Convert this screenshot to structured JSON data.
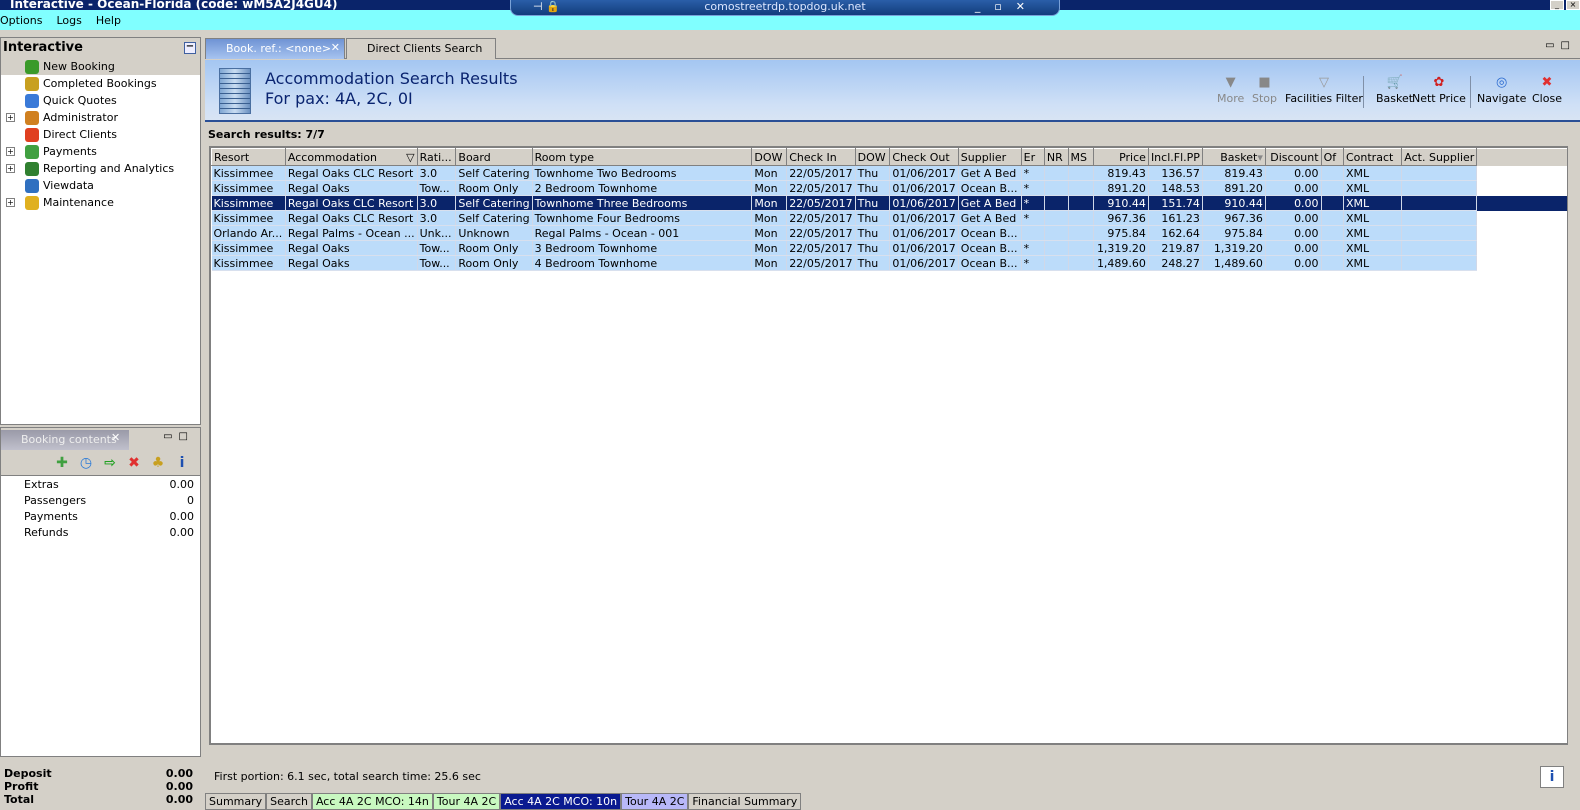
{
  "window": {
    "title": "Interactive - Ocean-Florida (code: wM5A2J4GU4)",
    "remote_host": "comostreetrdp.topdog.uk.net"
  },
  "menu": [
    "Options",
    "Logs",
    "Help"
  ],
  "left": {
    "title": "Interactive",
    "tree": [
      {
        "label": "New Booking",
        "expandable": false,
        "selected": true,
        "icon": "palm-tree-icon",
        "color": "#3a9a2a"
      },
      {
        "label": "Completed Bookings",
        "expandable": false,
        "icon": "palm-tree-icon",
        "color": "#c8a020"
      },
      {
        "label": "Quick Quotes",
        "expandable": false,
        "icon": "clock-icon",
        "color": "#3a7ad8"
      },
      {
        "label": "Administrator",
        "expandable": true,
        "icon": "person-icon",
        "color": "#d08020"
      },
      {
        "label": "Direct Clients",
        "expandable": false,
        "icon": "client-icon",
        "color": "#e04020"
      },
      {
        "label": "Payments",
        "expandable": true,
        "icon": "payments-icon",
        "color": "#40a040"
      },
      {
        "label": "Reporting and Analytics",
        "expandable": true,
        "icon": "report-icon",
        "color": "#308030"
      },
      {
        "label": "Viewdata",
        "expandable": false,
        "icon": "globe-icon",
        "color": "#3070c0"
      },
      {
        "label": "Maintenance",
        "expandable": true,
        "icon": "maintenance-icon",
        "color": "#e0b020"
      }
    ]
  },
  "booking_contents": {
    "title": "Booking contents",
    "tools": [
      {
        "name": "add-icon",
        "glyph": "✚",
        "color": "#40a040"
      },
      {
        "name": "clock-icon",
        "glyph": "◷",
        "color": "#2a7ad8"
      },
      {
        "name": "basket-transfer-icon",
        "glyph": "⇨",
        "color": "#20a020"
      },
      {
        "name": "delete-icon",
        "glyph": "✖",
        "color": "#e03030"
      },
      {
        "name": "palm-tree-icon",
        "glyph": "♣",
        "color": "#c8a020"
      },
      {
        "name": "info-icon",
        "glyph": "i",
        "color": "#1d4fb0"
      }
    ],
    "rows": [
      {
        "label": "Extras",
        "value": "0.00"
      },
      {
        "label": "Passengers",
        "value": "0"
      },
      {
        "label": "Payments",
        "value": "0.00"
      },
      {
        "label": "Refunds",
        "value": "0.00"
      }
    ]
  },
  "totals": [
    {
      "label": "Deposit",
      "value": "0.00"
    },
    {
      "label": "Profit",
      "value": "0.00"
    },
    {
      "label": "Total",
      "value": "0.00"
    }
  ],
  "tabs": [
    {
      "label": "Book. ref.: <none>"
    },
    {
      "label": "Direct Clients Search"
    }
  ],
  "header": {
    "title": "Accommodation Search Results",
    "subtitle": "For pax: 4A, 2C, 0I"
  },
  "toolbar": [
    {
      "label": "More",
      "glyph": "▼",
      "disabled": true,
      "name": "more-button",
      "icon": "more-icon"
    },
    {
      "label": "Stop",
      "glyph": "■",
      "disabled": true,
      "name": "stop-button",
      "icon": "stop-icon"
    },
    {
      "label": "Facilities Filter",
      "glyph": "▽",
      "disabled": false,
      "name": "facilities-filter-button",
      "icon": "funnel-icon"
    },
    {
      "label": "Basket",
      "glyph": "🛒",
      "disabled": false,
      "name": "basket-button",
      "icon": "basket-icon"
    },
    {
      "label": "Nett Price",
      "glyph": "✿",
      "disabled": false,
      "name": "nett-price-button",
      "icon": "nett-price-icon"
    },
    {
      "label": "Navigate",
      "glyph": "◎",
      "disabled": false,
      "name": "navigate-button",
      "icon": "compass-icon"
    },
    {
      "label": "Close",
      "glyph": "✖",
      "disabled": false,
      "name": "close-button",
      "icon": "close-icon"
    }
  ],
  "results": {
    "label": "Search results: 7/7",
    "columns": [
      "Resort",
      "Accommodation",
      "Rati...",
      "Board",
      "Room type",
      "DOW",
      "Check In",
      "DOW",
      "Check Out",
      "Supplier",
      "Er",
      "NR",
      "MS",
      "Price",
      "Incl.Fl.PP",
      "Basket",
      "Discount",
      "Of",
      "Contract",
      "Act. Supplier"
    ],
    "selected_row": 2,
    "rows": [
      [
        "Kissimmee",
        "Regal Oaks CLC Resort",
        "3.0",
        "Self Catering",
        "Townhome Two Bedrooms",
        "Mon",
        "22/05/2017",
        "Thu",
        "01/06/2017",
        "Get A Bed",
        "*",
        "",
        "",
        "819.43",
        "136.57",
        "819.43",
        "0.00",
        "",
        "XML",
        ""
      ],
      [
        "Kissimmee",
        "Regal Oaks",
        "Tow...",
        "Room Only",
        "2 Bedroom Townhome",
        "Mon",
        "22/05/2017",
        "Thu",
        "01/06/2017",
        "Ocean B...",
        "*",
        "",
        "",
        "891.20",
        "148.53",
        "891.20",
        "0.00",
        "",
        "XML",
        ""
      ],
      [
        "Kissimmee",
        "Regal Oaks CLC Resort",
        "3.0",
        "Self Catering",
        "Townhome Three Bedrooms",
        "Mon",
        "22/05/2017",
        "Thu",
        "01/06/2017",
        "Get A Bed",
        "*",
        "",
        "",
        "910.44",
        "151.74",
        "910.44",
        "0.00",
        "",
        "XML",
        ""
      ],
      [
        "Kissimmee",
        "Regal Oaks CLC Resort",
        "3.0",
        "Self Catering",
        "Townhome Four Bedrooms",
        "Mon",
        "22/05/2017",
        "Thu",
        "01/06/2017",
        "Get A Bed",
        "*",
        "",
        "",
        "967.36",
        "161.23",
        "967.36",
        "0.00",
        "",
        "XML",
        ""
      ],
      [
        "Orlando Ar...",
        "Regal Palms - Ocean ...",
        "Unk...",
        "Unknown",
        "Regal Palms - Ocean - 001",
        "Mon",
        "22/05/2017",
        "Thu",
        "01/06/2017",
        "Ocean B...",
        "",
        "",
        "",
        "975.84",
        "162.64",
        "975.84",
        "0.00",
        "",
        "XML",
        ""
      ],
      [
        "Kissimmee",
        "Regal Oaks",
        "Tow...",
        "Room Only",
        "3 Bedroom Townhome",
        "Mon",
        "22/05/2017",
        "Thu",
        "01/06/2017",
        "Ocean B...",
        "*",
        "",
        "",
        "1,319.20",
        "219.87",
        "1,319.20",
        "0.00",
        "",
        "XML",
        ""
      ],
      [
        "Kissimmee",
        "Regal Oaks",
        "Tow...",
        "Room Only",
        "4 Bedroom Townhome",
        "Mon",
        "22/05/2017",
        "Thu",
        "01/06/2017",
        "Ocean B...",
        "*",
        "",
        "",
        "1,489.60",
        "248.27",
        "1,489.60",
        "0.00",
        "",
        "XML",
        ""
      ]
    ]
  },
  "status": "First portion: 6.1 sec, total search time: 25.6 sec",
  "bottom_tabs": [
    {
      "label": "Summary",
      "bg": "#d4d0c8",
      "fg": "#000"
    },
    {
      "label": "Search",
      "bg": "#d4d0c8",
      "fg": "#000"
    },
    {
      "label": "Acc 4A 2C MCO: 14n",
      "bg": "#c8f8c0",
      "fg": "#000"
    },
    {
      "label": "Tour 4A 2C",
      "bg": "#c8f8c0",
      "fg": "#000"
    },
    {
      "label": "Acc 4A 2C MCO: 10n",
      "bg": "#0a1a90",
      "fg": "#fff"
    },
    {
      "label": "Tour 4A 2C",
      "bg": "#b8b8f8",
      "fg": "#000"
    },
    {
      "label": "Financial Summary",
      "bg": "#d4d0c8",
      "fg": "#000"
    }
  ]
}
